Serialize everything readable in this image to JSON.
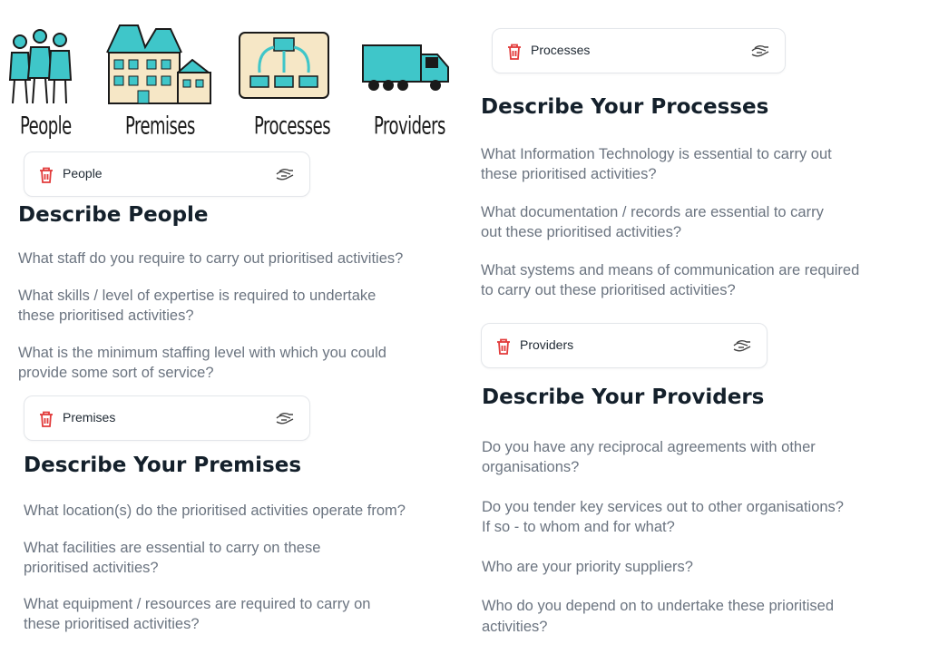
{
  "illustrations": [
    {
      "icon": "people-icon",
      "label": "People"
    },
    {
      "icon": "premises-icon",
      "label": "Premises"
    },
    {
      "icon": "processes-icon",
      "label": "Processes"
    },
    {
      "icon": "providers-icon",
      "label": "Providers"
    }
  ],
  "colors": {
    "accent_teal": "#3fc6c9",
    "delete_red": "#e23b3b",
    "muted_text": "#6b7480",
    "heading": "#14202b"
  },
  "sections": {
    "people": {
      "chip_label": "People",
      "heading": "Describe People",
      "questions": [
        "What staff do you require to carry out prioritised activities?",
        "What skills / level of expertise is required to undertake",
        "these prioritised activities?",
        "What is the minimum staffing level with which you could",
        "provide some sort of service?"
      ]
    },
    "premises": {
      "chip_label": "Premises",
      "heading": "Describe Your Premises",
      "questions": [
        "What location(s) do the prioritised activities operate from?",
        "What facilities are essential to carry on these",
        "prioritised activities?",
        "What equipment / resources are required to carry on",
        "these prioritised activities?"
      ]
    },
    "processes": {
      "chip_label": "Processes",
      "heading": "Describe Your Processes",
      "questions": [
        "What Information Technology is essential to carry out",
        "these prioritised activities?",
        "What documentation / records are essential to carry",
        "out these prioritised activities?",
        "What systems and means of communication are required",
        "to carry out these prioritised activities?"
      ]
    },
    "providers": {
      "chip_label": "Providers",
      "heading": "Describe Your Providers",
      "questions": [
        "Do you have any reciprocal agreements with other",
        "organisations?",
        "Do you tender key services out to other organisations?",
        "If so - to whom and for what?",
        "Who are your priority suppliers?",
        "Who do you depend on to undertake these prioritised",
        "activities?"
      ]
    }
  }
}
